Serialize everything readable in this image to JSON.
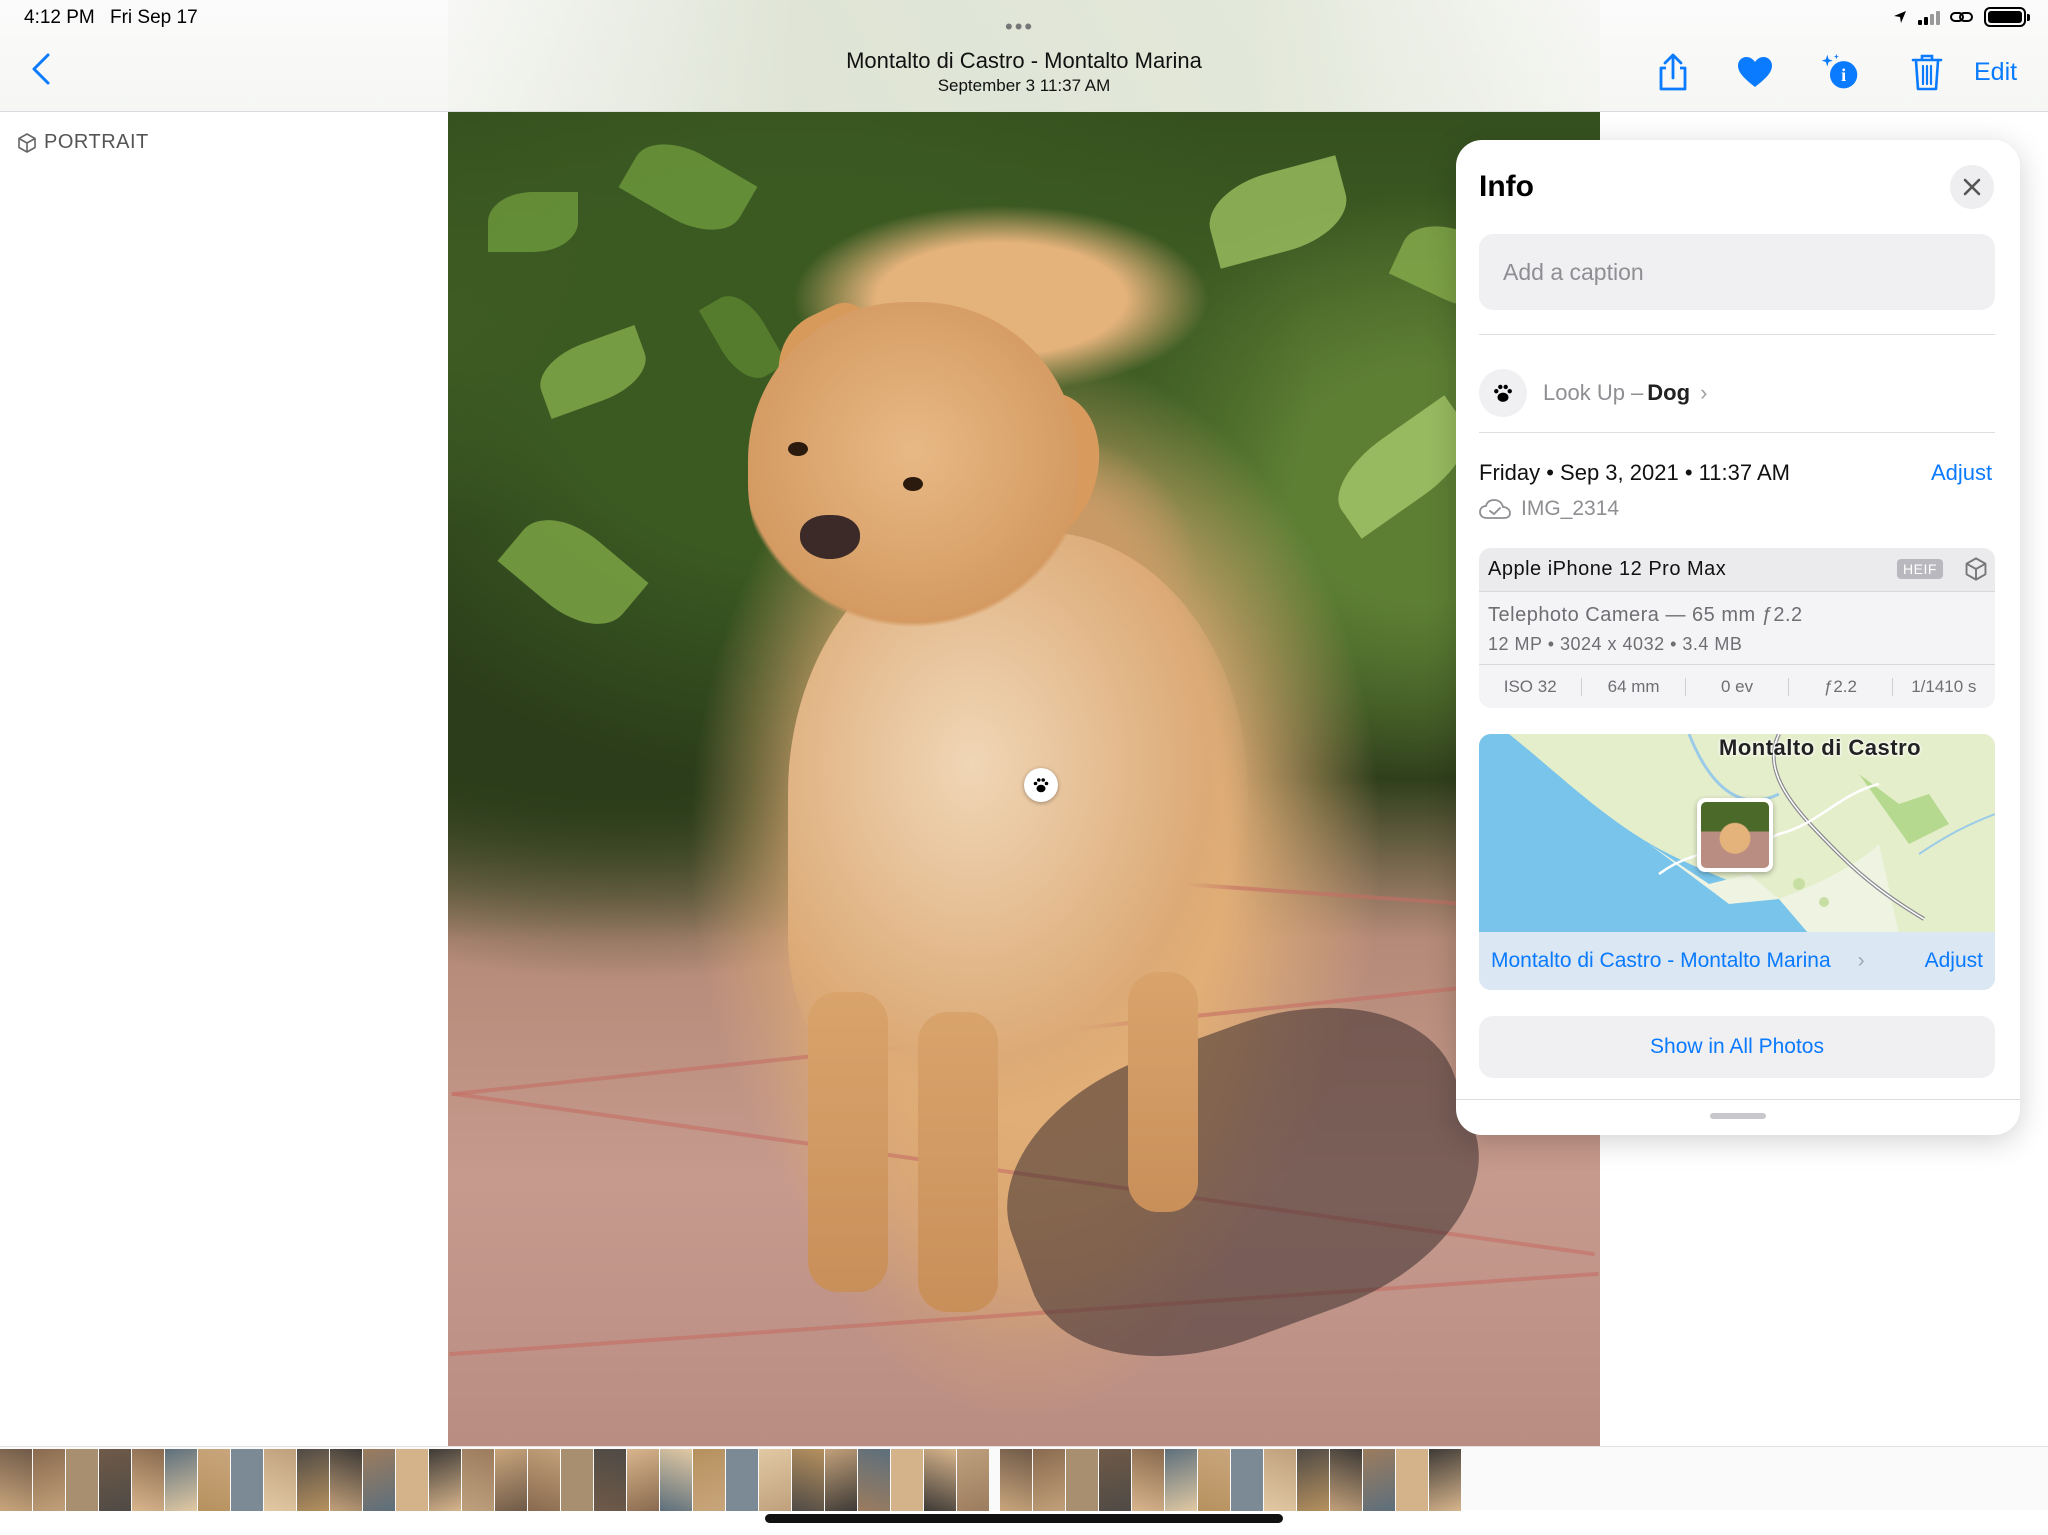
{
  "status": {
    "time": "4:12 PM",
    "date": "Fri Sep 17"
  },
  "toolbar": {
    "title": "Montalto di Castro - Montalto Marina",
    "subtitle": "September 3  11:37 AM",
    "edit_label": "Edit",
    "icons": [
      "chevron-left-icon",
      "share-icon",
      "heart-icon",
      "info-sparkle-icon",
      "trash-icon"
    ],
    "accent_color": "#0a7aff"
  },
  "photo_label": "PORTRAIT",
  "info": {
    "title": "Info",
    "caption_placeholder": "Add a caption",
    "lookup_prefix": "Look Up –",
    "lookup_subject": "Dog",
    "date_line": "Friday • Sep 3, 2021 • 11:37 AM",
    "adjust_label": "Adjust",
    "file_name": "IMG_2314",
    "camera": {
      "device": "Apple iPhone 12 Pro Max",
      "format_badge": "HEIF",
      "lens": "Telephoto Camera — 65 mm ƒ2.2",
      "specs": "12 MP  •  3024 x 4032  •  3.4 MB",
      "exif": [
        "ISO 32",
        "64 mm",
        "0 ev",
        "ƒ2.2",
        "1/1410 s"
      ]
    },
    "map": {
      "city_label": "Montalto di Castro",
      "place": "Montalto di Castro - Montalto Marina",
      "adjust_label": "Adjust"
    },
    "show_all_label": "Show in All Photos"
  }
}
